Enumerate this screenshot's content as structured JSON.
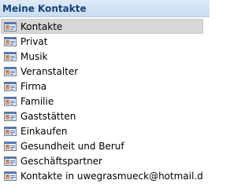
{
  "pane": {
    "title": "Meine Kontakte"
  },
  "folders": [
    {
      "label": "Kontakte",
      "icon": "contact-card-icon",
      "selected": true
    },
    {
      "label": "Privat",
      "icon": "contact-card-icon",
      "selected": false
    },
    {
      "label": "Musik",
      "icon": "contact-card-icon",
      "selected": false
    },
    {
      "label": "Veranstalter",
      "icon": "contact-card-icon",
      "selected": false
    },
    {
      "label": "Firma",
      "icon": "contact-card-icon",
      "selected": false
    },
    {
      "label": "Familie",
      "icon": "contact-card-icon",
      "selected": false
    },
    {
      "label": "Gaststätten",
      "icon": "contact-card-icon",
      "selected": false
    },
    {
      "label": "Einkaufen",
      "icon": "contact-card-icon",
      "selected": false
    },
    {
      "label": "Gesundheit und Beruf",
      "icon": "contact-card-icon",
      "selected": false
    },
    {
      "label": "Geschäftspartner",
      "icon": "contact-card-icon",
      "selected": false
    },
    {
      "label": "Kontakte in uwegrasmueck@hotmail.de",
      "icon": "contact-card-icon",
      "selected": false
    }
  ],
  "colors": {
    "header_bg": "#c9dcf1",
    "header_text": "#16427a",
    "selected_bg": "#d7d7d7"
  }
}
